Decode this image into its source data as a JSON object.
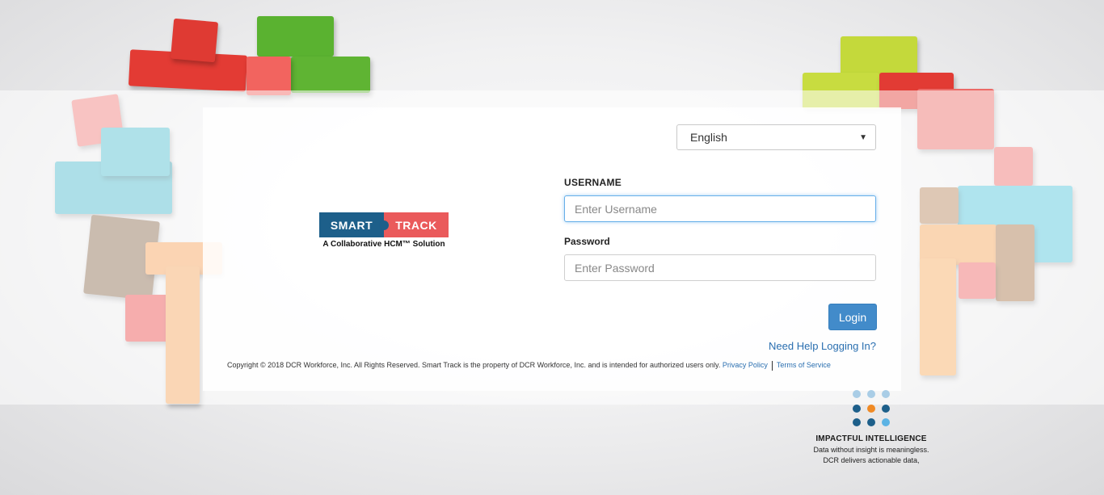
{
  "language": {
    "selected": "English"
  },
  "logo": {
    "smart": "SMART",
    "track": "TRACK",
    "tagline": "A Collaborative HCM™ Solution"
  },
  "form": {
    "username_label": "USERNAME",
    "username_placeholder": "Enter Username",
    "username_value": "",
    "password_label": "Password",
    "password_placeholder": "Enter Password",
    "password_value": "",
    "login_label": "Login",
    "help_link": "Need Help Logging In?"
  },
  "footer": {
    "copyright": "Copyright © 2018 DCR Workforce, Inc. All Rights Reserved. Smart Track is the property of DCR Workforce, Inc. and is intended for authorized users only.",
    "privacy_link": "Privacy Policy",
    "terms_link": "Terms of Service"
  },
  "brand_panel": {
    "title": "IMPACTFUL INTELLIGENCE",
    "line1": "Data without insight is meaningless.",
    "line2": "DCR delivers actionable data,"
  },
  "colors": {
    "smart_blue": "#1d5f8a",
    "track_red": "#ea5a5b",
    "button_blue": "#428bca",
    "link_blue": "#2a6fb0",
    "dot_dark": "#1d5f8a",
    "dot_light": "#a9cde6",
    "dot_orange": "#f08a24",
    "dot_sky": "#5cb3e4"
  },
  "icons": {
    "dropdown": "chevron-down-icon"
  }
}
